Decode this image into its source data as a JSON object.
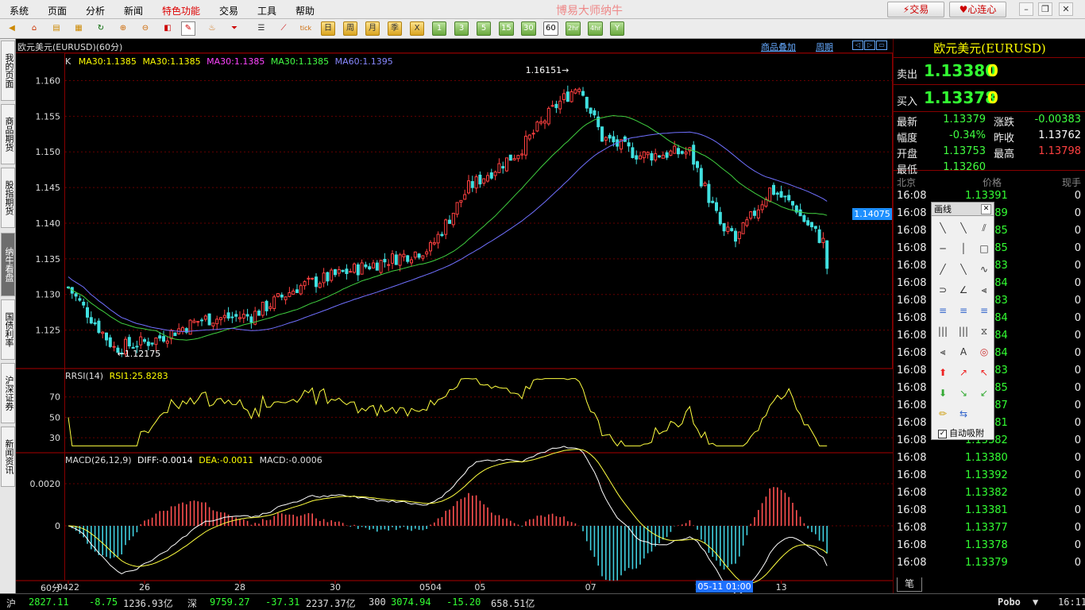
{
  "menu": {
    "items": [
      "系统",
      "页面",
      "分析",
      "新闻",
      "特色功能",
      "交易",
      "工具",
      "帮助"
    ],
    "title": "博易大师纳牛",
    "trade_btn": "交易",
    "connect_btn": "心连心"
  },
  "toolbar": {
    "period_buttons": [
      "日",
      "周",
      "月",
      "季",
      "X",
      "1",
      "3",
      "5",
      "15",
      "30",
      "60",
      "2hr",
      "4hr",
      "Y"
    ],
    "selected": "60"
  },
  "left_tabs": [
    "我的页面",
    "商品期货",
    "股指期货",
    "纳牛看盘",
    "国债利率",
    "沪深证券",
    "新闻资讯"
  ],
  "chart": {
    "instrument": "欧元美元(EURUSD)(60分)",
    "overlay_link": "商品叠加",
    "period_link": "周期",
    "ma_legend": [
      {
        "text": "K",
        "color": "#dddddd"
      },
      {
        "text": "MA30:1.1385",
        "color": "#ffff00"
      },
      {
        "text": "MA30:1.1385",
        "color": "#ffff00"
      },
      {
        "text": "MA30:1.1385",
        "color": "#ff40ff"
      },
      {
        "text": "MA30:1.1385",
        "color": "#40ff40"
      },
      {
        "text": "MA60:1.1395",
        "color": "#8080ff"
      }
    ],
    "high_label": "1.16151",
    "low_label": "1.12175",
    "price_axis": [
      "1.160",
      "1.155",
      "1.150",
      "1.145",
      "1.140",
      "1.135",
      "1.130",
      "1.125"
    ],
    "price_tag": "1.14075",
    "rsi_legend": {
      "name": "RRSI(14)",
      "value": "RSI1:25.8283"
    },
    "rsi_axis": [
      "70",
      "50",
      "30"
    ],
    "macd_legend": {
      "name": "MACD(26,12,9)",
      "diff": "DIFF:-0.0014",
      "dea": "DEA:-0.0011",
      "macd": "MACD:-0.0006"
    },
    "macd_axis": [
      "0.0020",
      "0"
    ],
    "x_axis": [
      "0422",
      "26",
      "28",
      "30",
      "0504",
      "05",
      "07",
      "1",
      "13"
    ],
    "period_label": "60分",
    "time_tag": "05-11 01:00"
  },
  "quote": {
    "title": "欧元美元(EURUSD)",
    "sell_label": "卖出",
    "sell_price": "1.13380",
    "sell_vol": "0",
    "buy_label": "买入",
    "buy_price": "1.13378",
    "buy_vol": "0",
    "stats": [
      {
        "l1": "最新",
        "v1": "1.13379",
        "c1": "#40ff40",
        "l2": "涨跌",
        "v2": "-0.00383",
        "c2": "#40ff40"
      },
      {
        "l1": "幅度",
        "v1": "-0.34%",
        "c1": "#40ff40",
        "l2": "昨收",
        "v2": "1.13762",
        "c2": "#ffffff"
      },
      {
        "l1": "开盘",
        "v1": "1.13753",
        "c1": "#40ff40",
        "l2": "最高",
        "v2": "1.13798",
        "c2": "#ff4040"
      },
      {
        "l1": "最低",
        "v1": "1.13260",
        "c1": "#40ff40",
        "l2": "",
        "v2": "",
        "c2": "#ffffff"
      }
    ],
    "ticks_head": [
      "北京",
      "价格",
      "现手"
    ],
    "ticks": [
      {
        "t": "16:08",
        "p": "1.13391",
        "v": "0"
      },
      {
        "t": "16:08",
        "p": "1.13389",
        "v": "0"
      },
      {
        "t": "16:08",
        "p": "1.13385",
        "v": "0"
      },
      {
        "t": "16:08",
        "p": "1.13385",
        "v": "0"
      },
      {
        "t": "16:08",
        "p": "1.13383",
        "v": "0"
      },
      {
        "t": "16:08",
        "p": "1.13384",
        "v": "0"
      },
      {
        "t": "16:08",
        "p": "1.13383",
        "v": "0"
      },
      {
        "t": "16:08",
        "p": "1.13384",
        "v": "0"
      },
      {
        "t": "16:08",
        "p": "1.13384",
        "v": "0"
      },
      {
        "t": "16:08",
        "p": "1.13384",
        "v": "0"
      },
      {
        "t": "16:08",
        "p": "1.13383",
        "v": "0"
      },
      {
        "t": "16:08",
        "p": "1.13385",
        "v": "0"
      },
      {
        "t": "16:08",
        "p": "1.13387",
        "v": "0"
      },
      {
        "t": "16:08",
        "p": "1.13381",
        "v": "0"
      },
      {
        "t": "16:08",
        "p": "1.13382",
        "v": "0"
      },
      {
        "t": "16:08",
        "p": "1.13380",
        "v": "0"
      },
      {
        "t": "16:08",
        "p": "1.13392",
        "v": "0"
      },
      {
        "t": "16:08",
        "p": "1.13382",
        "v": "0"
      },
      {
        "t": "16:08",
        "p": "1.13381",
        "v": "0"
      },
      {
        "t": "16:08",
        "p": "1.13377",
        "v": "0"
      },
      {
        "t": "16:08",
        "p": "1.13378",
        "v": "0"
      },
      {
        "t": "16:08",
        "p": "1.13379",
        "v": "0"
      }
    ],
    "tab": "笔"
  },
  "draw_panel": {
    "title": "画线",
    "auto_attach": "自动吸附"
  },
  "status": {
    "sh_label": "沪",
    "sh_idx": "2827.11",
    "sh_chg": "-8.75",
    "sh_amt": "1236.93亿",
    "sz_label": "深",
    "sz_idx": "9759.27",
    "sz_chg": "-37.31",
    "sz_amt": "2237.37亿",
    "hs_label": "300",
    "hs_idx": "3074.94",
    "hs_chg": "-15.20",
    "hs_amt": "658.51亿",
    "brand": "Pobo",
    "time": "16:11"
  }
}
